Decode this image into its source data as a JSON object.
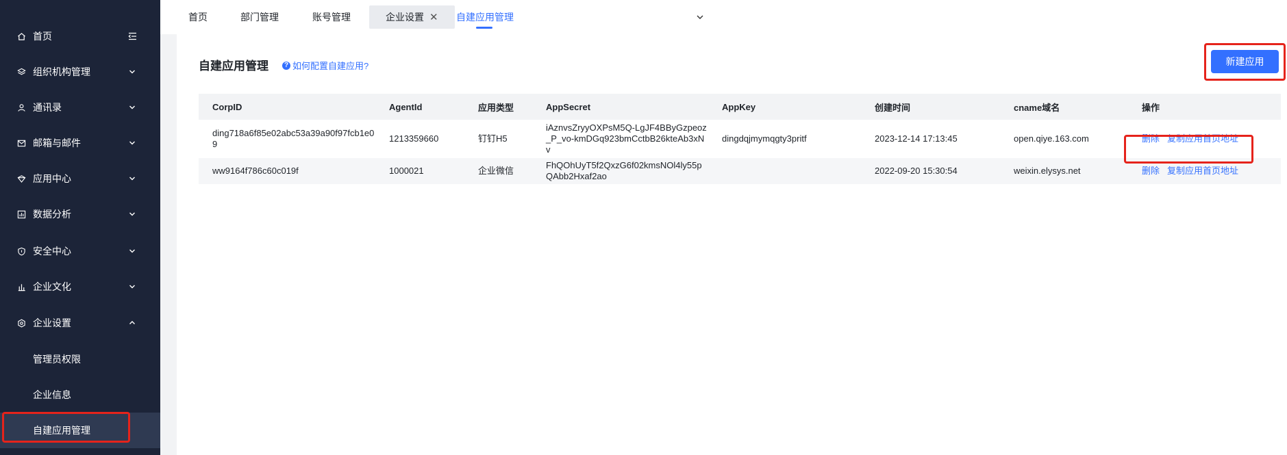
{
  "sidebar": {
    "items": [
      {
        "label": "首页",
        "icon": "home-icon"
      },
      {
        "label": "组织机构管理",
        "icon": "layers-icon"
      },
      {
        "label": "通讯录",
        "icon": "user-icon"
      },
      {
        "label": "邮箱与邮件",
        "icon": "mail-icon"
      },
      {
        "label": "应用中心",
        "icon": "app-icon"
      },
      {
        "label": "数据分析",
        "icon": "chart-icon"
      },
      {
        "label": "安全中心",
        "icon": "shield-icon"
      },
      {
        "label": "企业文化",
        "icon": "bar-icon"
      },
      {
        "label": "企业设置",
        "icon": "settings-icon"
      }
    ],
    "sub_items": [
      {
        "label": "管理员权限"
      },
      {
        "label": "企业信息"
      },
      {
        "label": "自建应用管理",
        "active": true
      }
    ]
  },
  "tabs": [
    {
      "label": "首页"
    },
    {
      "label": "部门管理"
    },
    {
      "label": "账号管理"
    },
    {
      "label": "企业设置",
      "closable": true
    },
    {
      "label": "自建应用管理",
      "active": true
    }
  ],
  "main": {
    "title": "自建应用管理",
    "help_link": "如何配置自建应用?",
    "new_button": "新建应用"
  },
  "table": {
    "columns": [
      "CorpID",
      "AgentId",
      "应用类型",
      "AppSecret",
      "AppKey",
      "创建时间",
      "cname域名",
      "操作"
    ],
    "rows": [
      {
        "corpid": "ding718a6f85e02abc53a39a90f97fcb1e09",
        "agentid": "1213359660",
        "type": "钉钉H5",
        "secret": "iAznvsZryyOXPsM5Q-LgJF4BByGzpeoz_P_vo-kmDGq923bmCctbB26kteAb3xNv",
        "appkey": "dingdqjmymqgty3pritf",
        "created": "2023-12-14 17:13:45",
        "cname": "open.qiye.163.com",
        "op_delete": "删除",
        "op_copy": "复制应用首页地址"
      },
      {
        "corpid": "ww9164f786c60c019f",
        "agentid": "1000021",
        "type": "企业微信",
        "secret": "FhQOhUyT5f2QxzG6f02kmsNOl4ly55pQAbb2Hxaf2ao",
        "appkey": "",
        "created": "2022-09-20 15:30:54",
        "cname": "weixin.elysys.net",
        "op_delete": "删除",
        "op_copy": "复制应用首页地址"
      }
    ]
  },
  "colors": {
    "sidebar_bg": "#1c2438",
    "accent": "#3370ff",
    "highlight_box": "#e5231b"
  }
}
